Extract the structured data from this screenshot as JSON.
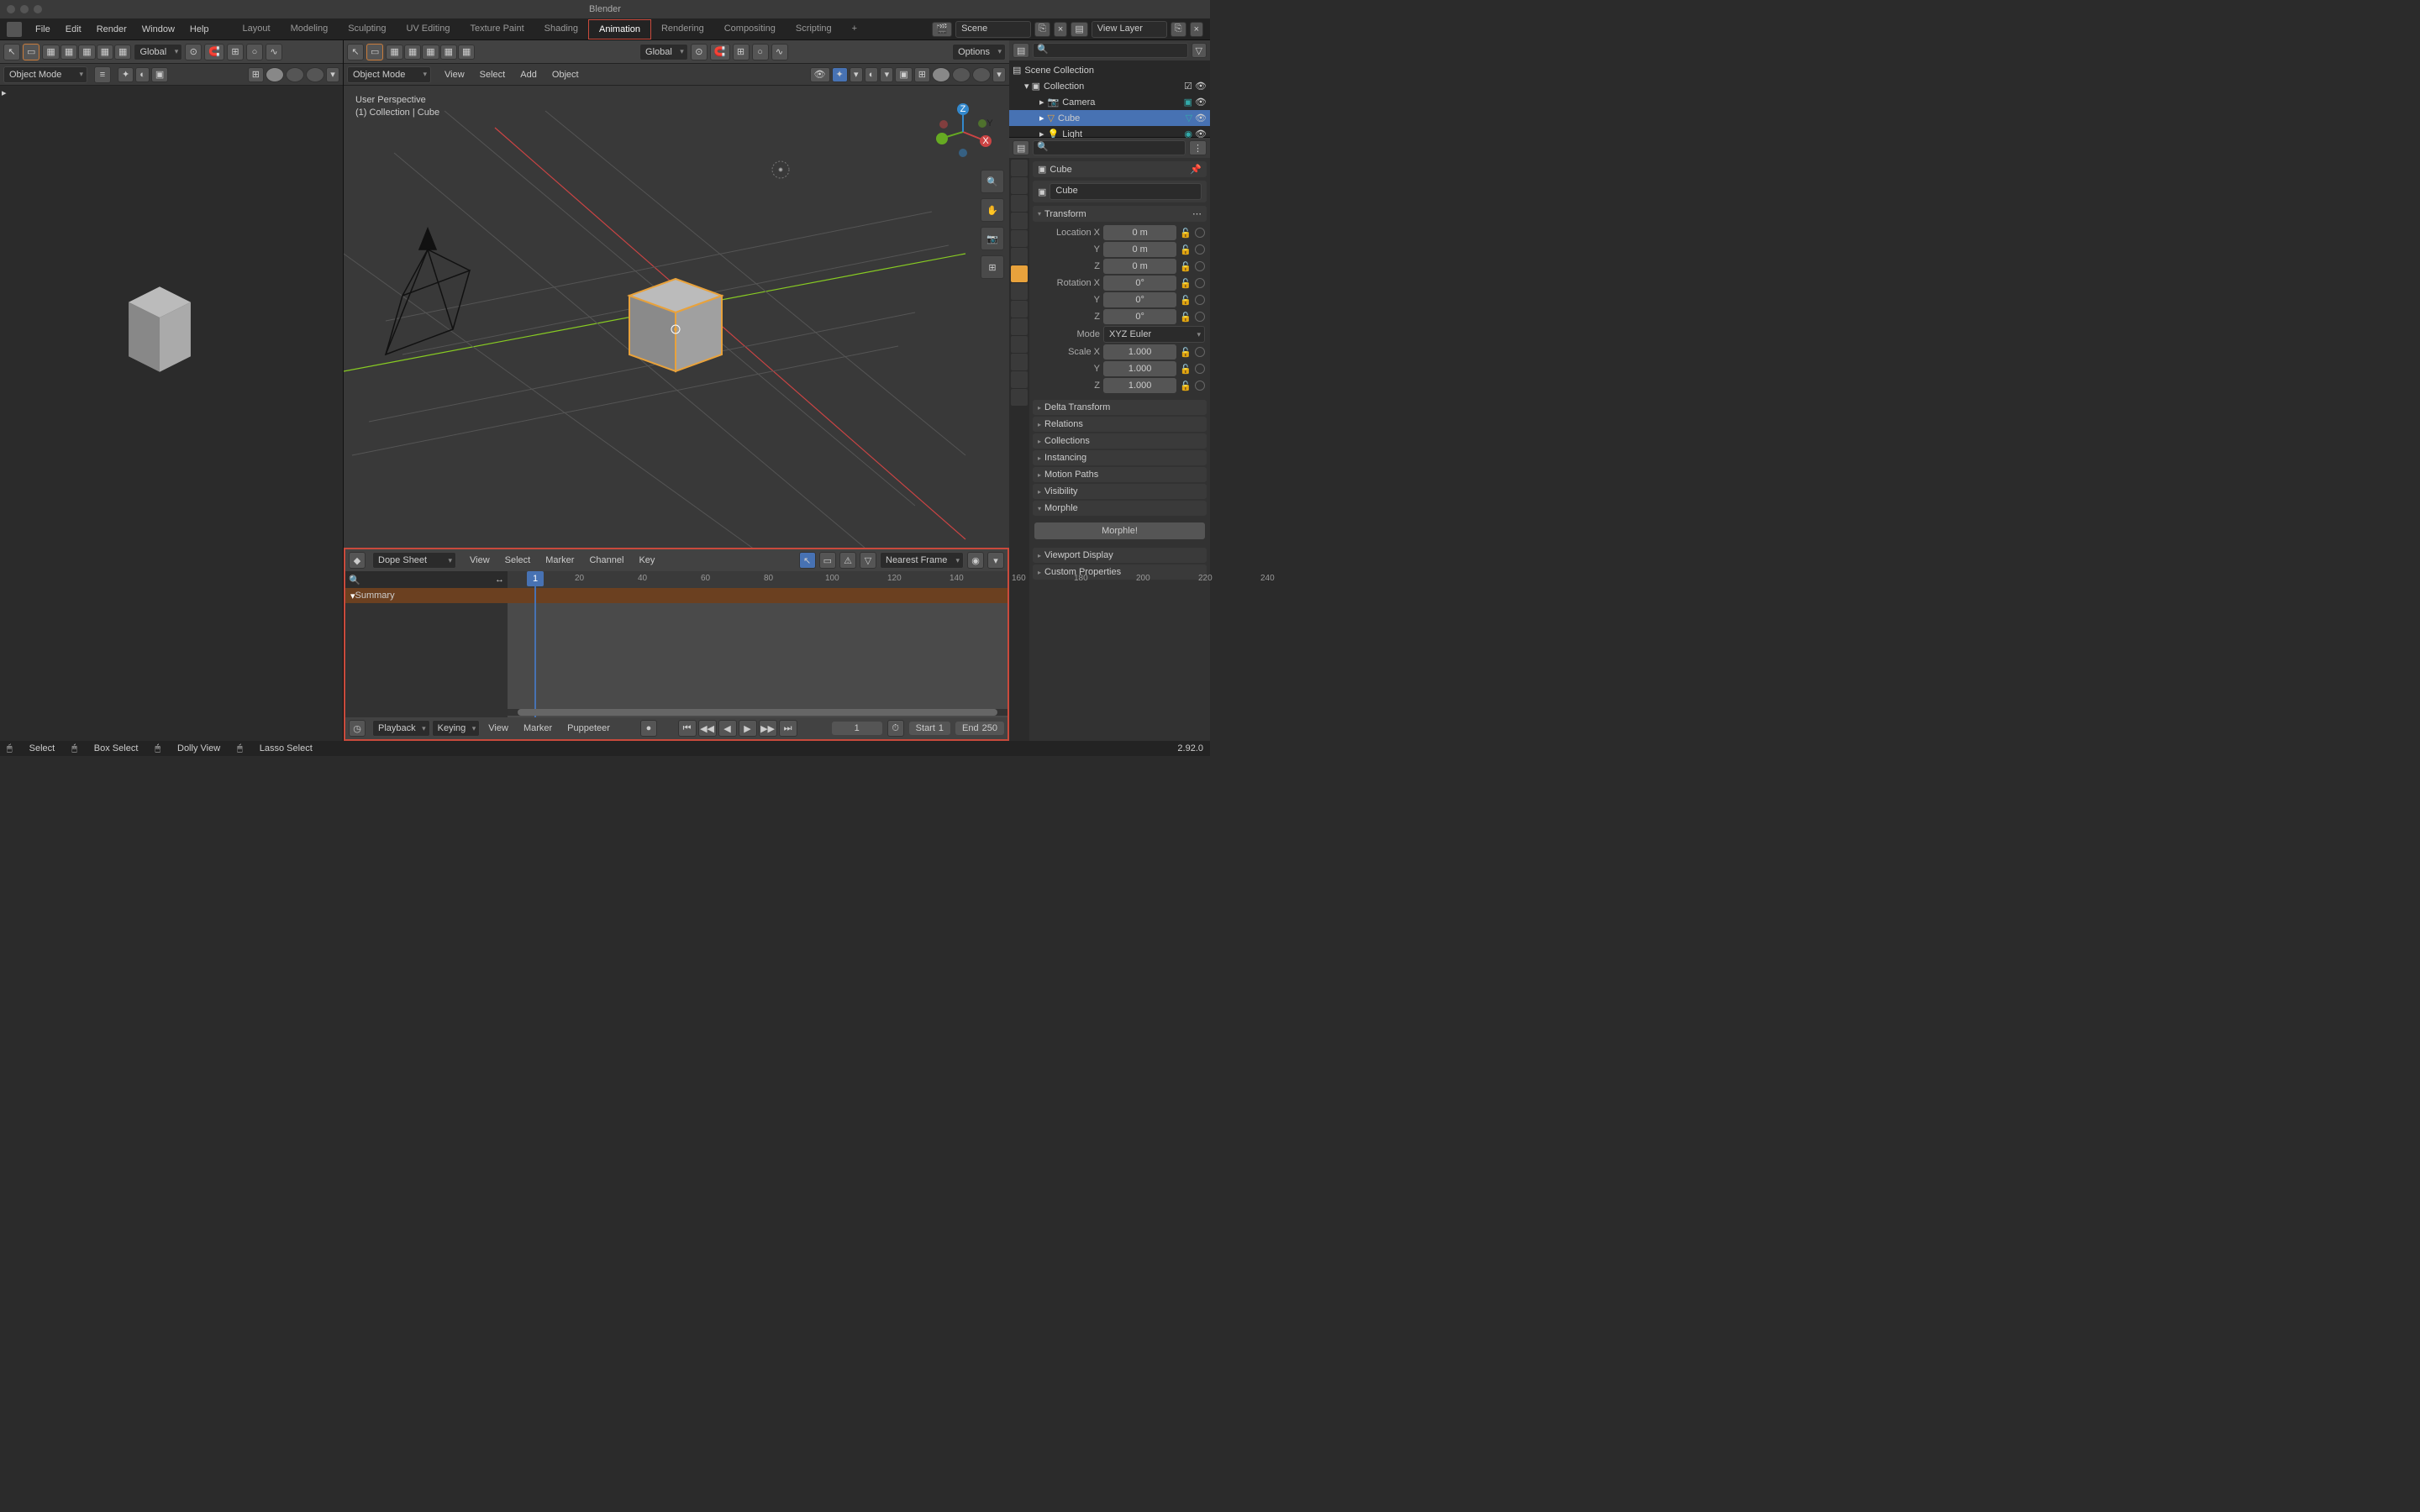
{
  "app_title": "Blender",
  "version": "2.92.0",
  "menu": {
    "file": "File",
    "edit": "Edit",
    "render": "Render",
    "window": "Window",
    "help": "Help"
  },
  "workspaces": [
    "Layout",
    "Modeling",
    "Sculpting",
    "UV Editing",
    "Texture Paint",
    "Shading",
    "Animation",
    "Rendering",
    "Compositing",
    "Scripting"
  ],
  "active_workspace": "Animation",
  "scene_label": "Scene",
  "viewlayer_label": "View Layer",
  "left_viewport": {
    "mode": "Object Mode",
    "orientation": "Global"
  },
  "center_viewport": {
    "mode": "Object Mode",
    "orientation": "Global",
    "menus": [
      "View",
      "Select",
      "Add",
      "Object"
    ],
    "options_label": "Options",
    "overlay": {
      "line1": "User Perspective",
      "line2": "(1) Collection | Cube"
    }
  },
  "dopesheet": {
    "editor": "Dope Sheet",
    "menus": [
      "View",
      "Select",
      "Marker",
      "Channel",
      "Key"
    ],
    "snap": "Nearest Frame",
    "summary": "Summary",
    "ticks": [
      "20",
      "40",
      "60",
      "80",
      "100",
      "120",
      "140",
      "160",
      "180",
      "200",
      "220",
      "240"
    ],
    "current_frame": "1",
    "playback_menus": [
      "Playback",
      "Keying",
      "View",
      "Marker",
      "Puppeteer"
    ],
    "frame": "1",
    "start_label": "Start",
    "start": "1",
    "end_label": "End",
    "end": "250"
  },
  "status": {
    "select": "Select",
    "box": "Box Select",
    "dolly": "Dolly View",
    "lasso": "Lasso Select"
  },
  "outliner": {
    "root": "Scene Collection",
    "collection": "Collection",
    "items": [
      {
        "name": "Camera",
        "type": "camera"
      },
      {
        "name": "Cube",
        "type": "mesh",
        "selected": true
      },
      {
        "name": "Light",
        "type": "light"
      }
    ]
  },
  "properties": {
    "object_name": "Cube",
    "datablock": "Cube",
    "transform_label": "Transform",
    "loc": {
      "x": "Location X",
      "y": "Y",
      "z": "Z",
      "vx": "0 m",
      "vy": "0 m",
      "vz": "0 m"
    },
    "rot": {
      "x": "Rotation X",
      "y": "Y",
      "z": "Z",
      "vx": "0°",
      "vy": "0°",
      "vz": "0°"
    },
    "mode_label": "Mode",
    "mode_val": "XYZ Euler",
    "scale": {
      "x": "Scale X",
      "y": "Y",
      "z": "Z",
      "vx": "1.000",
      "vy": "1.000",
      "vz": "1.000"
    },
    "panels": [
      "Delta Transform",
      "Relations",
      "Collections",
      "Instancing",
      "Motion Paths",
      "Visibility",
      "Morphle",
      "Viewport Display",
      "Custom Properties"
    ],
    "morphle_btn": "Morphle!"
  }
}
